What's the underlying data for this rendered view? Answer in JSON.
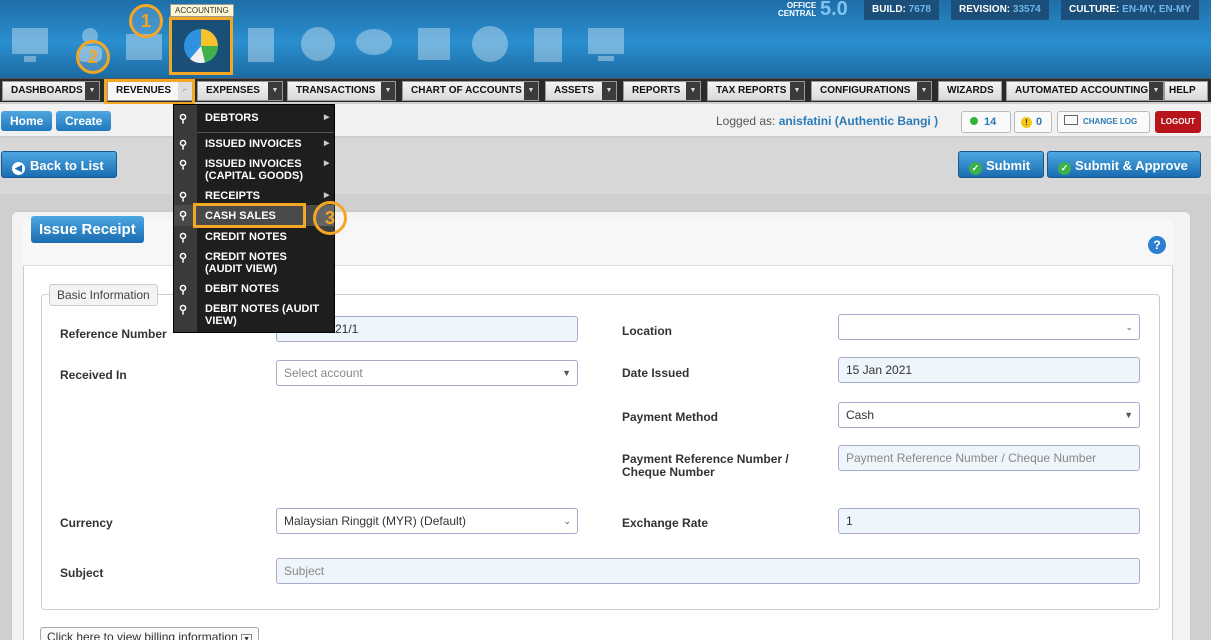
{
  "header": {
    "tooltip": "ACCOUNTING",
    "office_central_line1": "OFFICE",
    "office_central_line2": "CENTRAL",
    "version": "5.0",
    "build_label": "BUILD:",
    "build_value": "7678",
    "revision_label": "REVISION:",
    "revision_value": "33574",
    "culture_label": "CULTURE:",
    "culture_value": "EN-MY, EN-MY"
  },
  "callouts": [
    "1",
    "2",
    "3"
  ],
  "nav": {
    "items": [
      "DASHBOARDS",
      "REVENUES",
      "EXPENSES",
      "TRANSACTIONS",
      "CHART OF ACCOUNTS",
      "ASSETS",
      "REPORTS",
      "TAX REPORTS",
      "CONFIGURATIONS",
      "WIZARDS",
      "AUTOMATED ACCOUNTING",
      "HELP"
    ]
  },
  "dropdown": {
    "items": [
      "DEBTORS",
      "ISSUED INVOICES",
      "ISSUED INVOICES (CAPITAL GOODS)",
      "RECEIPTS",
      "CASH SALES",
      "CREDIT NOTES",
      "CREDIT NOTES (AUDIT VIEW)",
      "DEBIT NOTES",
      "DEBIT NOTES (AUDIT VIEW)"
    ]
  },
  "breadcrumb": {
    "home": "Home",
    "create": "Create"
  },
  "user": {
    "logged_as_label": "Logged as:",
    "name": "anisfatini (Authentic Bangi )",
    "online_count": "14",
    "alert_count": "0",
    "change_log": "CHANGE LOG",
    "logout": "LOGOUT"
  },
  "actions": {
    "back": "Back to List",
    "submit": "Submit",
    "submit_approve": "Submit & Approve"
  },
  "form": {
    "title": "Issue Receipt",
    "section": "Basic Information",
    "help": "?",
    "reference_label": "Reference Number",
    "reference_value": "21/1",
    "received_in_label": "Received In",
    "received_in_placeholder": "Select account",
    "location_label": "Location",
    "location_value": "",
    "date_label": "Date Issued",
    "date_value": "15 Jan 2021",
    "payment_method_label": "Payment Method",
    "payment_method_value": "Cash",
    "payment_ref_label_1": "Payment Reference Number /",
    "payment_ref_label_2": "Cheque Number",
    "payment_ref_placeholder": "Payment Reference Number / Cheque Number",
    "currency_label": "Currency",
    "currency_value": "Malaysian Ringgit (MYR) (Default)",
    "exchange_label": "Exchange Rate",
    "exchange_value": "1",
    "subject_label": "Subject",
    "subject_placeholder": "Subject",
    "billing_link": "Click here to view billing information"
  }
}
